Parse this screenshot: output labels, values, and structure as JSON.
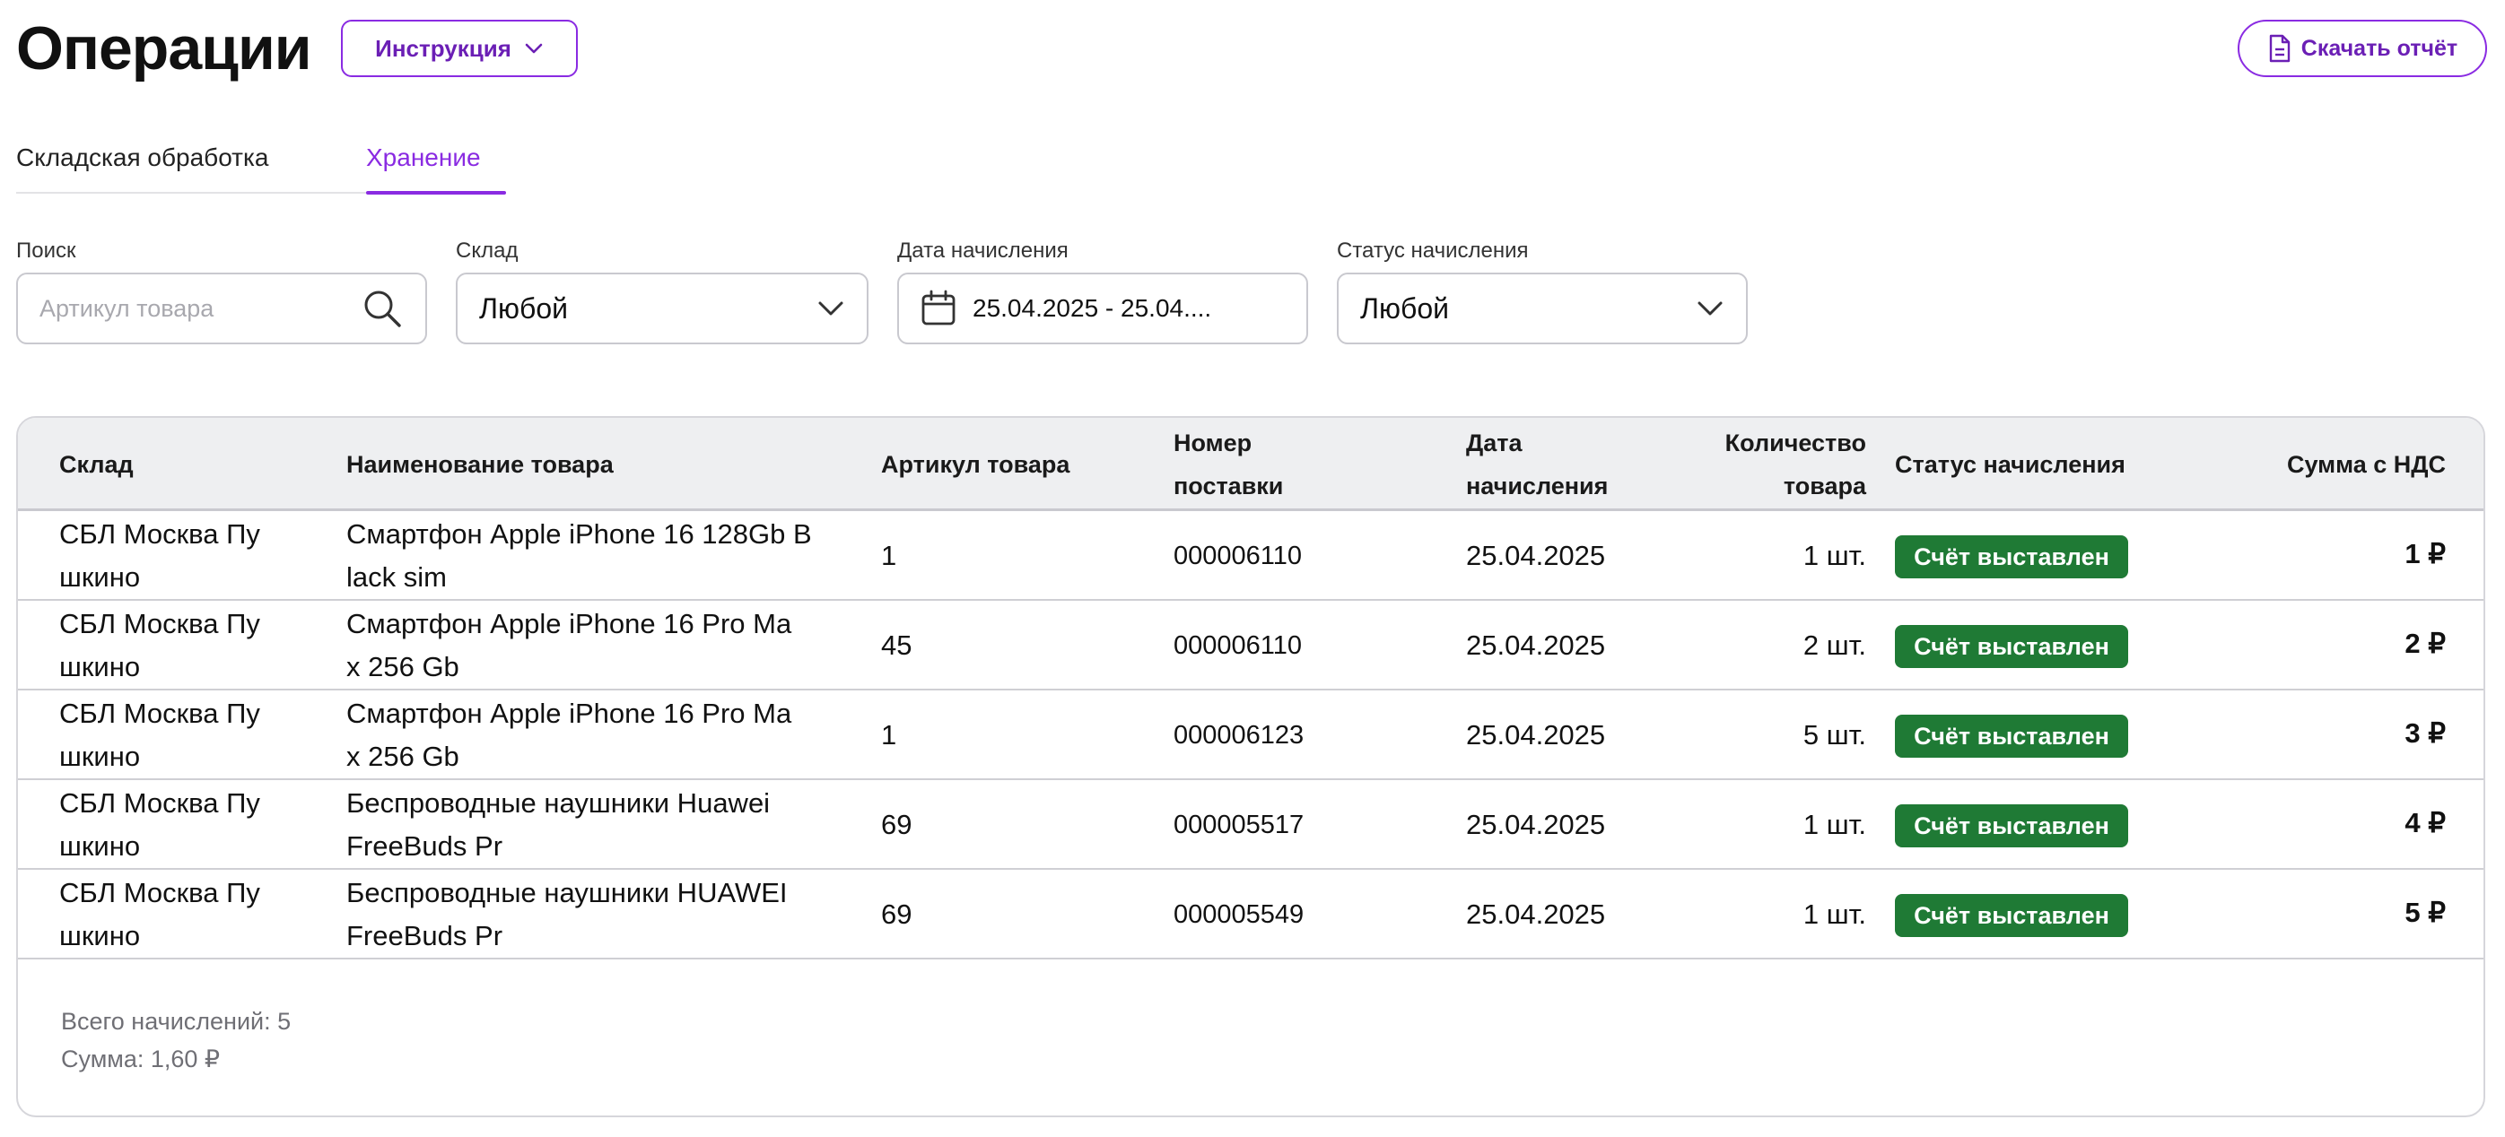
{
  "header": {
    "title": "Операции",
    "instruction_label": "Инструкция",
    "report_label": "Скачать отчёт"
  },
  "tabs": [
    {
      "label": "Складская обработка",
      "active": false
    },
    {
      "label": "Хранение",
      "active": true
    }
  ],
  "filters": {
    "search": {
      "label": "Поиск",
      "placeholder": "Артикул товара",
      "value": ""
    },
    "warehouse": {
      "label": "Склад",
      "value": "Любой"
    },
    "date": {
      "label": "Дата начисления",
      "value": "25.04.2025 - 25.04...."
    },
    "status": {
      "label": "Статус начисления",
      "value": "Любой"
    }
  },
  "table": {
    "headers": {
      "warehouse": "Склад",
      "product": "Наименование товара",
      "sku": "Артикул товара",
      "supply_1": "Номер",
      "supply_2": "поставки",
      "date_1": "Дата",
      "date_2": "начисления",
      "qty_1": "Количество",
      "qty_2": "товара",
      "status": "Статус начисления",
      "sum": "Сумма с НДС"
    },
    "rows": [
      {
        "wh1": "СБЛ Москва Пу",
        "wh2": "шкино",
        "p1": "Смартфон Apple iPhone 16 128Gb B",
        "p2": "lack sim",
        "sku": "1",
        "supply": "000006110",
        "date": "25.04.2025",
        "qty": "1 шт.",
        "status": "Счёт выставлен",
        "sum": "1 ₽"
      },
      {
        "wh1": "СБЛ Москва Пу",
        "wh2": "шкино",
        "p1": "Смартфон Apple iPhone 16 Pro Ma",
        "p2": "x 256 Gb",
        "sku": "45",
        "supply": "000006110",
        "date": "25.04.2025",
        "qty": "2 шт.",
        "status": "Счёт выставлен",
        "sum": "2 ₽"
      },
      {
        "wh1": "СБЛ Москва Пу",
        "wh2": "шкино",
        "p1": "Смартфон Apple iPhone 16 Pro Ma",
        "p2": "x 256 Gb",
        "sku": "1",
        "supply": "000006123",
        "date": "25.04.2025",
        "qty": "5 шт.",
        "status": "Счёт выставлен",
        "sum": "3 ₽"
      },
      {
        "wh1": "СБЛ Москва Пу",
        "wh2": "шкино",
        "p1": "Беспроводные наушники Huawei",
        "p2": "FreeBuds Pr",
        "sku": "69",
        "supply": "000005517",
        "date": "25.04.2025",
        "qty": "1 шт.",
        "status": "Счёт выставлен",
        "sum": "4 ₽"
      },
      {
        "wh1": "СБЛ Москва Пу",
        "wh2": "шкино",
        "p1": "Беспроводные наушники HUAWEI",
        "p2": "FreeBuds Pr",
        "sku": "69",
        "supply": "000005549",
        "date": "25.04.2025",
        "qty": "1 шт.",
        "status": "Счёт выставлен",
        "sum": "5 ₽"
      }
    ]
  },
  "summary": {
    "total_label": "Всего начислений: 5",
    "sum_label": "Сумма: 1,60 ₽"
  },
  "colors": {
    "accent": "#8a2be2",
    "status_green": "#1f7a35"
  }
}
